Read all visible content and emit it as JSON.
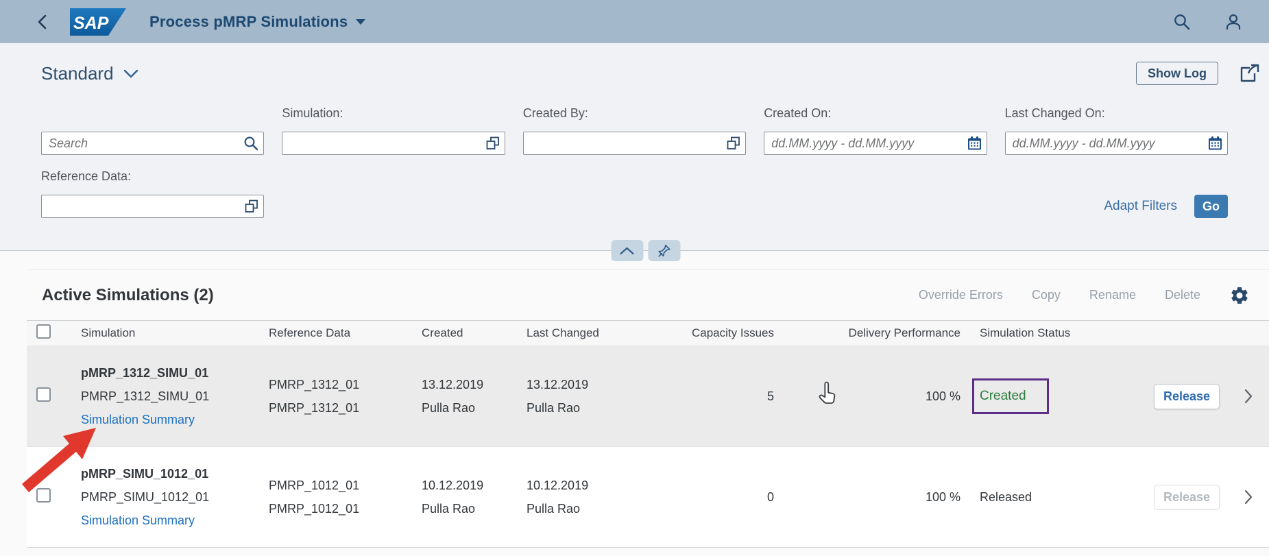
{
  "header": {
    "logo_text": "SAP",
    "app_title": "Process pMRP Simulations"
  },
  "variant_bar": {
    "variant_name": "Standard",
    "show_log_label": "Show Log"
  },
  "filter_bar": {
    "search": {
      "placeholder": "Search"
    },
    "simulation_label": "Simulation:",
    "created_by_label": "Created By:",
    "created_on_label": "Created On:",
    "created_on_placeholder": "dd.MM.yyyy - dd.MM.yyyy",
    "last_changed_on_label": "Last Changed On:",
    "last_changed_on_placeholder": "dd.MM.yyyy - dd.MM.yyyy",
    "reference_data_label": "Reference Data:",
    "adapt_filters_label": "Adapt Filters",
    "go_label": "Go"
  },
  "table": {
    "title": "Active Simulations (2)",
    "toolbar": {
      "override_errors": "Override Errors",
      "copy": "Copy",
      "rename": "Rename",
      "delete": "Delete"
    },
    "columns": {
      "simulation": "Simulation",
      "reference_data": "Reference Data",
      "created": "Created",
      "last_changed": "Last Changed",
      "capacity_issues": "Capacity Issues",
      "delivery_performance": "Delivery Performance",
      "simulation_status": "Simulation Status"
    },
    "rows": [
      {
        "name": "pMRP_1312_SIMU_01",
        "id": "PMRP_1312_SIMU_01",
        "summary_link": "Simulation Summary",
        "reference_1": "PMRP_1312_01",
        "reference_2": "PMRP_1312_01",
        "created_date": "13.12.2019",
        "created_by": "Pulla Rao",
        "last_changed_date": "13.12.2019",
        "last_changed_by": "Pulla Rao",
        "capacity_issues": "5",
        "delivery_performance": "100 %",
        "status": "Created",
        "status_color": "#2b7c3c",
        "action_label": "Release",
        "action_enabled": true
      },
      {
        "name": "pMRP_SIMU_1012_01",
        "id": "PMRP_SIMU_1012_01",
        "summary_link": "Simulation Summary",
        "reference_1": "PMRP_1012_01",
        "reference_2": "PMRP_1012_01",
        "created_date": "10.12.2019",
        "created_by": "Pulla Rao",
        "last_changed_date": "10.12.2019",
        "last_changed_by": "Pulla Rao",
        "capacity_issues": "0",
        "delivery_performance": "100 %",
        "status": "Released",
        "status_color": "#32363a",
        "action_label": "Release",
        "action_enabled": false
      }
    ]
  },
  "annotations": {
    "arrow_color": "#e0382d",
    "status_highlight_color": "#5d2d87"
  },
  "colors": {
    "header_bar": "#a3b8cb",
    "accent_blue": "#3b7ab1",
    "link_blue": "#1b6fc0",
    "status_positive": "#2b7c3c"
  }
}
